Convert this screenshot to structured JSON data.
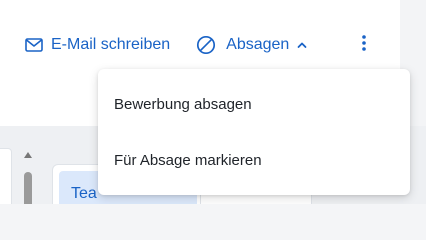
{
  "toolbar": {
    "email_label": "E-Mail schreiben",
    "absagen_label": "Absagen",
    "email_icon": "mail-icon",
    "absagen_icon": "ban-icon",
    "chevron_icon": "chevron-up-icon",
    "more_icon": "more-vertical-icon"
  },
  "dropdown": {
    "items": [
      {
        "label": "Bewerbung absagen"
      },
      {
        "label": "Für Absage markieren"
      }
    ]
  },
  "board": {
    "column_chip_label": "Tea"
  },
  "colors": {
    "accent": "#1a63c6",
    "text": "#1f2329",
    "chip_bg": "#dbe8fb"
  }
}
